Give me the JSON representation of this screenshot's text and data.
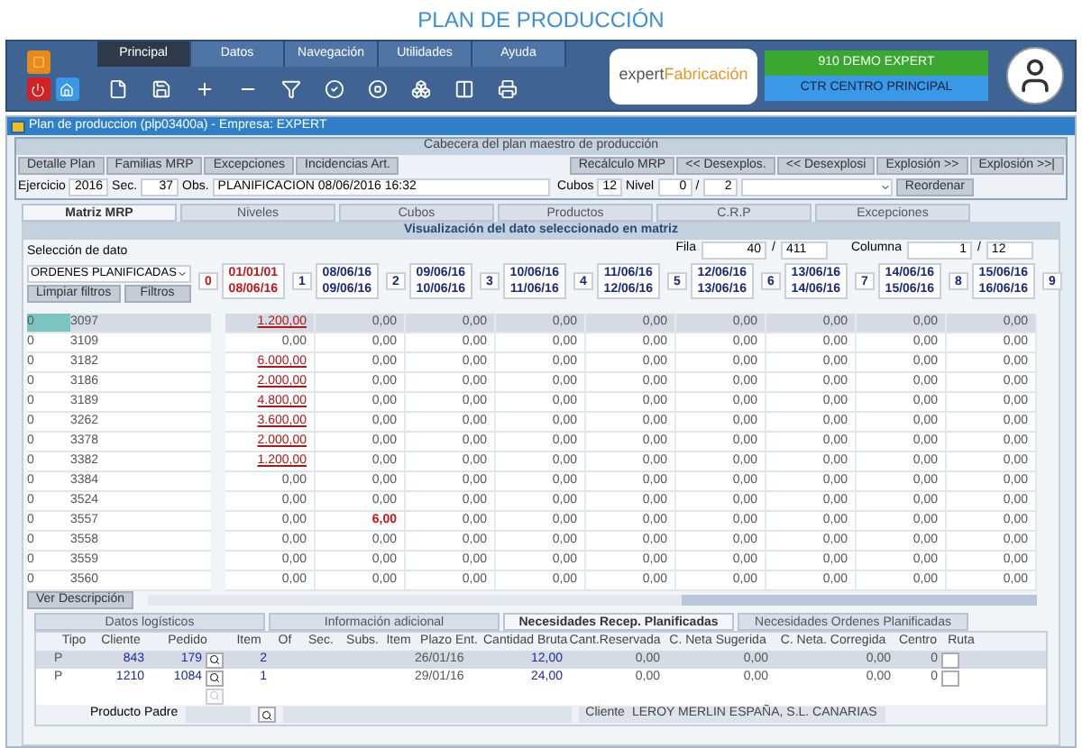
{
  "page_title": "PLAN DE PRODUCCIÓN",
  "menu_tabs": [
    {
      "label": "Principal",
      "selected": true
    },
    {
      "label": "Datos",
      "selected": false
    },
    {
      "label": "Navegación",
      "selected": false
    },
    {
      "label": "Utilidades",
      "selected": false
    },
    {
      "label": "Ayuda",
      "selected": false
    }
  ],
  "logo": {
    "part_1": "expert",
    "part_2": "Fabricación"
  },
  "company": "910 DEMO EXPERT",
  "center": "CTR CENTRO PRINCIPAL",
  "window_title": "Plan de produccion (plp03400a) -  Empresa: EXPERT",
  "plan_header": {
    "title": "Cabecera del plan maestro de producción",
    "left_buttons": [
      "Detalle Plan",
      "Familias MRP",
      "Excepciones",
      "Incidencias Art."
    ],
    "right_buttons": [
      "Recálculo MRP",
      "<< Desexplos.",
      "<< Desexplosi",
      "Explosión >>",
      "Explosión >>|"
    ],
    "exercise": {
      "label": "Ejercicio",
      "value": "2016"
    },
    "sequence": {
      "label": "Sec.",
      "value": "37"
    },
    "notes": {
      "label": "Obs.",
      "value": "PLANIFICACION 08/06/2016 16:32"
    },
    "buckets": {
      "label": "Cubos",
      "value": "12"
    },
    "level_field": {
      "label": "Nivel",
      "value": "0",
      "separator": "/",
      "total": "2"
    },
    "reorder_button": "Reordenar"
  },
  "view_tabs": [
    {
      "label": "Matriz MRP",
      "selected": true
    },
    {
      "label": "Niveles",
      "selected": false
    },
    {
      "label": "Cubos",
      "selected": false
    },
    {
      "label": "Productos",
      "selected": false
    },
    {
      "label": "C.R.P",
      "selected": false
    },
    {
      "label": "Excepciones",
      "selected": false
    }
  ],
  "matrix": {
    "title": "Visualización del dato seleccionado en matriz",
    "selection_label": "Selección de dato",
    "selection_value": "ORDENES PLANIFICADAS",
    "clear_filters_button": "Limpiar filtros",
    "filters_button": "Filtros",
    "row_position": {
      "label": "Fila",
      "value": "40",
      "separator": "/",
      "total": "411"
    },
    "column_position": {
      "label": "Columna",
      "value": "1",
      "separator": "/",
      "total": "12"
    },
    "columns": [
      {
        "index": "0",
        "from": "01/01/01",
        "to": "08/06/16",
        "highlighted": true
      },
      {
        "index": "1",
        "from": "08/06/16",
        "to": "09/06/16",
        "highlighted": false
      },
      {
        "index": "2",
        "from": "09/06/16",
        "to": "10/06/16",
        "highlighted": false
      },
      {
        "index": "3",
        "from": "10/06/16",
        "to": "11/06/16",
        "highlighted": false
      },
      {
        "index": "4",
        "from": "11/06/16",
        "to": "12/06/16",
        "highlighted": false
      },
      {
        "index": "5",
        "from": "12/06/16",
        "to": "13/06/16",
        "highlighted": false
      },
      {
        "index": "6",
        "from": "13/06/16",
        "to": "14/06/16",
        "highlighted": false
      },
      {
        "index": "7",
        "from": "14/06/16",
        "to": "15/06/16",
        "highlighted": false
      },
      {
        "index": "8",
        "from": "15/06/16",
        "to": "16/06/16",
        "highlighted": false
      }
    ],
    "trailing_index": "9",
    "rows": [
      {
        "level": "0",
        "item": "3097",
        "selected": true,
        "cells": [
          {
            "text": "1.200,00",
            "kind": "link"
          },
          {
            "text": "0,00",
            "kind": "plain"
          },
          {
            "text": "0,00",
            "kind": "plain"
          },
          {
            "text": "0,00",
            "kind": "plain"
          },
          {
            "text": "0,00",
            "kind": "plain"
          },
          {
            "text": "0,00",
            "kind": "plain"
          },
          {
            "text": "0,00",
            "kind": "plain"
          },
          {
            "text": "0,00",
            "kind": "plain"
          },
          {
            "text": "0,00",
            "kind": "plain"
          }
        ]
      },
      {
        "level": "0",
        "item": "3109",
        "selected": false,
        "cells": [
          {
            "text": "0,00",
            "kind": "plain"
          },
          {
            "text": "0,00",
            "kind": "plain"
          },
          {
            "text": "0,00",
            "kind": "plain"
          },
          {
            "text": "0,00",
            "kind": "plain"
          },
          {
            "text": "0,00",
            "kind": "plain"
          },
          {
            "text": "0,00",
            "kind": "plain"
          },
          {
            "text": "0,00",
            "kind": "plain"
          },
          {
            "text": "0,00",
            "kind": "plain"
          },
          {
            "text": "0,00",
            "kind": "plain"
          }
        ]
      },
      {
        "level": "0",
        "item": "3182",
        "selected": false,
        "cells": [
          {
            "text": "6.000,00",
            "kind": "link"
          },
          {
            "text": "0,00",
            "kind": "plain"
          },
          {
            "text": "0,00",
            "kind": "plain"
          },
          {
            "text": "0,00",
            "kind": "plain"
          },
          {
            "text": "0,00",
            "kind": "plain"
          },
          {
            "text": "0,00",
            "kind": "plain"
          },
          {
            "text": "0,00",
            "kind": "plain"
          },
          {
            "text": "0,00",
            "kind": "plain"
          },
          {
            "text": "0,00",
            "kind": "plain"
          }
        ]
      },
      {
        "level": "0",
        "item": "3186",
        "selected": false,
        "cells": [
          {
            "text": "2.000,00",
            "kind": "link"
          },
          {
            "text": "0,00",
            "kind": "plain"
          },
          {
            "text": "0,00",
            "kind": "plain"
          },
          {
            "text": "0,00",
            "kind": "plain"
          },
          {
            "text": "0,00",
            "kind": "plain"
          },
          {
            "text": "0,00",
            "kind": "plain"
          },
          {
            "text": "0,00",
            "kind": "plain"
          },
          {
            "text": "0,00",
            "kind": "plain"
          },
          {
            "text": "0,00",
            "kind": "plain"
          }
        ]
      },
      {
        "level": "0",
        "item": "3189",
        "selected": false,
        "cells": [
          {
            "text": "4.800,00",
            "kind": "link"
          },
          {
            "text": "0,00",
            "kind": "plain"
          },
          {
            "text": "0,00",
            "kind": "plain"
          },
          {
            "text": "0,00",
            "kind": "plain"
          },
          {
            "text": "0,00",
            "kind": "plain"
          },
          {
            "text": "0,00",
            "kind": "plain"
          },
          {
            "text": "0,00",
            "kind": "plain"
          },
          {
            "text": "0,00",
            "kind": "plain"
          },
          {
            "text": "0,00",
            "kind": "plain"
          }
        ]
      },
      {
        "level": "0",
        "item": "3262",
        "selected": false,
        "cells": [
          {
            "text": "3.600,00",
            "kind": "link"
          },
          {
            "text": "0,00",
            "kind": "plain"
          },
          {
            "text": "0,00",
            "kind": "plain"
          },
          {
            "text": "0,00",
            "kind": "plain"
          },
          {
            "text": "0,00",
            "kind": "plain"
          },
          {
            "text": "0,00",
            "kind": "plain"
          },
          {
            "text": "0,00",
            "kind": "plain"
          },
          {
            "text": "0,00",
            "kind": "plain"
          },
          {
            "text": "0,00",
            "kind": "plain"
          }
        ]
      },
      {
        "level": "0",
        "item": "3378",
        "selected": false,
        "cells": [
          {
            "text": "2.000,00",
            "kind": "link"
          },
          {
            "text": "0,00",
            "kind": "plain"
          },
          {
            "text": "0,00",
            "kind": "plain"
          },
          {
            "text": "0,00",
            "kind": "plain"
          },
          {
            "text": "0,00",
            "kind": "plain"
          },
          {
            "text": "0,00",
            "kind": "plain"
          },
          {
            "text": "0,00",
            "kind": "plain"
          },
          {
            "text": "0,00",
            "kind": "plain"
          },
          {
            "text": "0,00",
            "kind": "plain"
          }
        ]
      },
      {
        "level": "0",
        "item": "3382",
        "selected": false,
        "cells": [
          {
            "text": "1.200,00",
            "kind": "link"
          },
          {
            "text": "0,00",
            "kind": "plain"
          },
          {
            "text": "0,00",
            "kind": "plain"
          },
          {
            "text": "0,00",
            "kind": "plain"
          },
          {
            "text": "0,00",
            "kind": "plain"
          },
          {
            "text": "0,00",
            "kind": "plain"
          },
          {
            "text": "0,00",
            "kind": "plain"
          },
          {
            "text": "0,00",
            "kind": "plain"
          },
          {
            "text": "0,00",
            "kind": "plain"
          }
        ]
      },
      {
        "level": "0",
        "item": "3384",
        "selected": false,
        "cells": [
          {
            "text": "0,00",
            "kind": "plain"
          },
          {
            "text": "0,00",
            "kind": "plain"
          },
          {
            "text": "0,00",
            "kind": "plain"
          },
          {
            "text": "0,00",
            "kind": "plain"
          },
          {
            "text": "0,00",
            "kind": "plain"
          },
          {
            "text": "0,00",
            "kind": "plain"
          },
          {
            "text": "0,00",
            "kind": "plain"
          },
          {
            "text": "0,00",
            "kind": "plain"
          },
          {
            "text": "0,00",
            "kind": "plain"
          }
        ]
      },
      {
        "level": "0",
        "item": "3524",
        "selected": false,
        "cells": [
          {
            "text": "0,00",
            "kind": "plain"
          },
          {
            "text": "0,00",
            "kind": "plain"
          },
          {
            "text": "0,00",
            "kind": "plain"
          },
          {
            "text": "0,00",
            "kind": "plain"
          },
          {
            "text": "0,00",
            "kind": "plain"
          },
          {
            "text": "0,00",
            "kind": "plain"
          },
          {
            "text": "0,00",
            "kind": "plain"
          },
          {
            "text": "0,00",
            "kind": "plain"
          },
          {
            "text": "0,00",
            "kind": "plain"
          }
        ]
      },
      {
        "level": "0",
        "item": "3557",
        "selected": false,
        "cells": [
          {
            "text": "0,00",
            "kind": "plain"
          },
          {
            "text": "6,00",
            "kind": "alert"
          },
          {
            "text": "0,00",
            "kind": "plain"
          },
          {
            "text": "0,00",
            "kind": "plain"
          },
          {
            "text": "0,00",
            "kind": "plain"
          },
          {
            "text": "0,00",
            "kind": "plain"
          },
          {
            "text": "0,00",
            "kind": "plain"
          },
          {
            "text": "0,00",
            "kind": "plain"
          },
          {
            "text": "0,00",
            "kind": "plain"
          }
        ]
      },
      {
        "level": "0",
        "item": "3558",
        "selected": false,
        "cells": [
          {
            "text": "0,00",
            "kind": "plain"
          },
          {
            "text": "0,00",
            "kind": "plain"
          },
          {
            "text": "0,00",
            "kind": "plain"
          },
          {
            "text": "0,00",
            "kind": "plain"
          },
          {
            "text": "0,00",
            "kind": "plain"
          },
          {
            "text": "0,00",
            "kind": "plain"
          },
          {
            "text": "0,00",
            "kind": "plain"
          },
          {
            "text": "0,00",
            "kind": "plain"
          },
          {
            "text": "0,00",
            "kind": "plain"
          }
        ]
      },
      {
        "level": "0",
        "item": "3559",
        "selected": false,
        "cells": [
          {
            "text": "0,00",
            "kind": "plain"
          },
          {
            "text": "0,00",
            "kind": "plain"
          },
          {
            "text": "0,00",
            "kind": "plain"
          },
          {
            "text": "0,00",
            "kind": "plain"
          },
          {
            "text": "0,00",
            "kind": "plain"
          },
          {
            "text": "0,00",
            "kind": "plain"
          },
          {
            "text": "0,00",
            "kind": "plain"
          },
          {
            "text": "0,00",
            "kind": "plain"
          },
          {
            "text": "0,00",
            "kind": "plain"
          }
        ]
      },
      {
        "level": "0",
        "item": "3560",
        "selected": false,
        "cells": [
          {
            "text": "0,00",
            "kind": "plain"
          },
          {
            "text": "0,00",
            "kind": "plain"
          },
          {
            "text": "0,00",
            "kind": "plain"
          },
          {
            "text": "0,00",
            "kind": "plain"
          },
          {
            "text": "0,00",
            "kind": "plain"
          },
          {
            "text": "0,00",
            "kind": "plain"
          },
          {
            "text": "0,00",
            "kind": "plain"
          },
          {
            "text": "0,00",
            "kind": "plain"
          },
          {
            "text": "0,00",
            "kind": "plain"
          }
        ]
      }
    ],
    "description_button": "Ver Descripción"
  },
  "detail_tabs": [
    {
      "label": "Datos logísticos",
      "selected": false
    },
    {
      "label": "Información adicional",
      "selected": false
    },
    {
      "label": "Necesidades Recep. Planificadas",
      "selected": true
    },
    {
      "label": "Necesidades Ordenes Planificadas",
      "selected": false
    }
  ],
  "detail_table": {
    "columns": [
      "Tipo",
      "Cliente",
      "Pedido",
      "Item",
      "Of",
      "Sec.",
      "Subs.",
      "Item",
      "Plazo Ent.",
      "Cantidad Bruta",
      "Cant.Reservada",
      "C. Neta Sugerida",
      "C. Neta. Corregida",
      "Centro",
      "Ruta"
    ],
    "rows": [
      {
        "cells": [
          "P",
          "843",
          "179",
          "2",
          "",
          "",
          "",
          "",
          "26/01/16",
          "12,00",
          "0,00",
          "0,00",
          "0,00",
          "0"
        ],
        "selected": true
      },
      {
        "cells": [
          "P",
          "1210",
          "1084",
          "1",
          "",
          "",
          "",
          "",
          "29/01/16",
          "24,00",
          "0,00",
          "0,00",
          "0,00",
          "0"
        ],
        "selected": false
      }
    ]
  },
  "parent_product": {
    "label": "Producto Padre"
  },
  "customer": {
    "label": "Cliente",
    "value": "LEROY MERLIN ESPAÑA, S.L. CANARIAS"
  }
}
